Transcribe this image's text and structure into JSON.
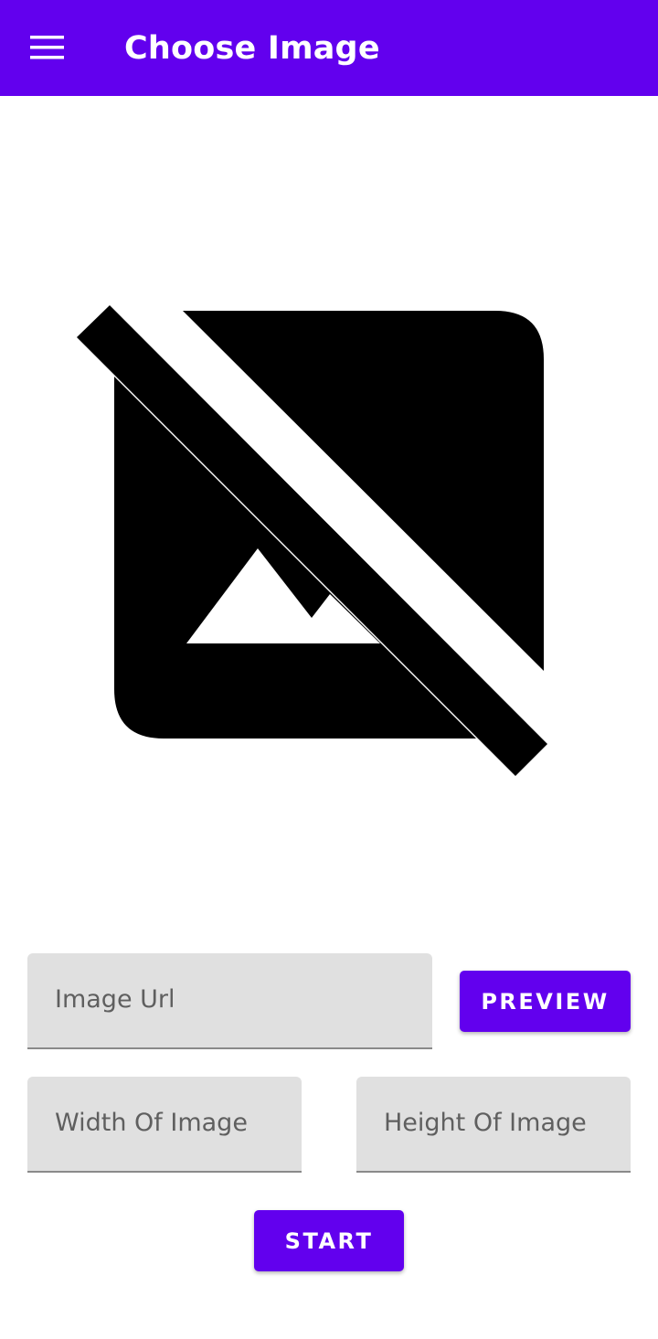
{
  "app_bar": {
    "title": "Choose Image",
    "menu_icon": "hamburger-menu-icon",
    "color": "#6200ee"
  },
  "preview": {
    "icon": "image-not-supported-icon"
  },
  "form": {
    "image_url": {
      "placeholder": "Image Url",
      "value": ""
    },
    "preview_button": "PREVIEW",
    "width": {
      "placeholder": "Width Of Image",
      "value": ""
    },
    "height": {
      "placeholder": "Height Of Image",
      "value": ""
    },
    "start_button": "START"
  }
}
